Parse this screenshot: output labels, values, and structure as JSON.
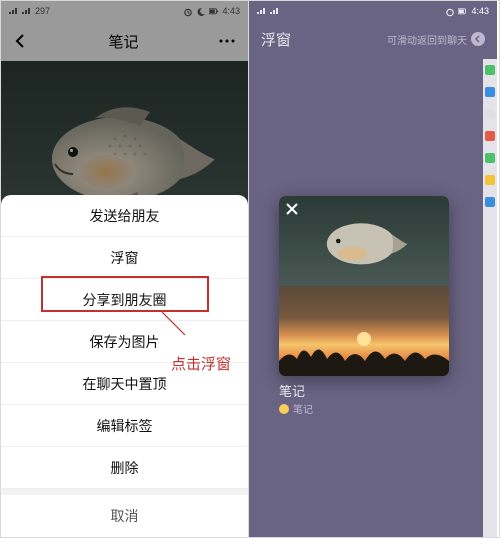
{
  "statusbar": {
    "left_text": "297",
    "time": "4:43",
    "time_right": "4:43"
  },
  "left": {
    "title": "笔记",
    "sheet": {
      "items": [
        "发送给朋友",
        "浮窗",
        "分享到朋友圈",
        "保存为图片",
        "在聊天中置顶",
        "编辑标签",
        "删除"
      ],
      "cancel": "取消",
      "highlighted_index": 1
    },
    "annotation": "点击浮窗"
  },
  "right": {
    "title": "浮窗",
    "hint": "可滑动返回到聊天",
    "card_label": "笔记",
    "card_sub": "笔记"
  }
}
